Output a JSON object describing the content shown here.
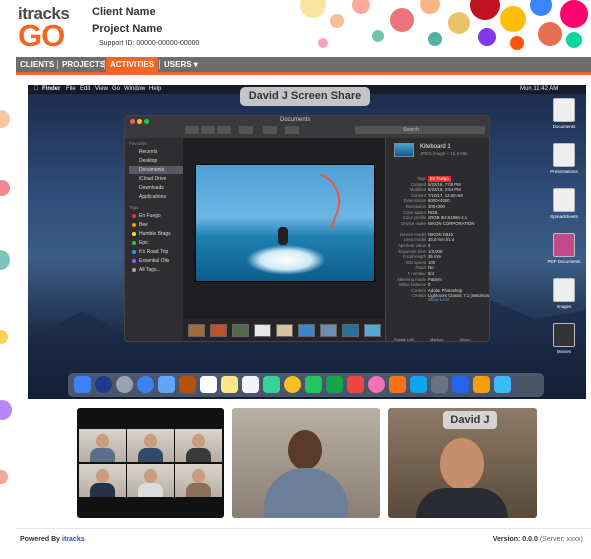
{
  "brand": {
    "logo_top": "itracks",
    "logo_bottom": "GO"
  },
  "header": {
    "client_name": "Client Name",
    "project_name": "Project Name",
    "support_id": "Support ID: 00000-00000-00000"
  },
  "nav": {
    "items": [
      "CLIENTS",
      "PROJECTS",
      "ACTIVITIES",
      "USERS ▾"
    ],
    "active": "ACTIVITIES"
  },
  "screen_share": {
    "label": "David J Screen Share",
    "menubar": {
      "apple": "",
      "items": [
        "Finder",
        "File",
        "Edit",
        "View",
        "Go",
        "Window",
        "Help"
      ],
      "clock": "Mon 11:42 AM"
    },
    "finder": {
      "title": "Documents",
      "search_placeholder": "Search",
      "sidebar_sections": [
        "Favorites",
        "Tags"
      ],
      "favorites": [
        "Recents",
        "Desktop",
        "Documents",
        "iCloud Drive",
        "Downloads",
        "Applications"
      ],
      "tags": [
        "En Fuego",
        "Bee",
        "Humble Brags",
        "Epic",
        "It's Road Trip",
        "Essential Oils",
        "All Tags..."
      ],
      "file": {
        "name": "Kiteboard 1",
        "type": "JPEG image – 15.4 MB"
      },
      "metadata": [
        [
          "Tags",
          "En Fuego"
        ],
        [
          "Created",
          "5/22/18, 7:09 PM"
        ],
        [
          "Modified",
          "5/22/18, 2:54 PM"
        ],
        [
          "Content",
          "7/10/17, 12:00 AM"
        ],
        [
          "Dimensions",
          "6000×4000"
        ],
        [
          "Resolution",
          "300×300"
        ],
        [
          "Color space",
          "RGB"
        ],
        [
          "Color profile",
          "sRGB IEC61966-2.1"
        ],
        [
          "Device make",
          "NIKON CORPORATION"
        ],
        [
          "Device model",
          "NIKON D810"
        ],
        [
          "Lens model",
          "35.0 mm f/1.4"
        ],
        [
          "Aperture value",
          "4"
        ],
        [
          "Exposure time",
          "1/3,000"
        ],
        [
          "Focal length",
          "35 mm"
        ],
        [
          "ISO speed",
          "100"
        ],
        [
          "Flash",
          "No"
        ],
        [
          "F number",
          "5/4"
        ],
        [
          "Metering mode",
          "Pattern"
        ],
        [
          "White balance",
          "0"
        ],
        [
          "Content",
          "Adobe Photoshop"
        ],
        [
          "Creator",
          "Lightroom Classic 7.1 (Macintosh)"
        ]
      ],
      "show_less": "Show Less",
      "actions": [
        "Rotate Left",
        "Markup",
        "More..."
      ]
    },
    "desktop_icons": [
      "Documents",
      "Presentations",
      "Spreadsheets",
      "PDF Documents",
      "Images",
      "Movies"
    ]
  },
  "video": {
    "participant_label": "David J"
  },
  "footer": {
    "powered_prefix": "Powered By",
    "powered_brand": "itracks",
    "version": "Version: 0.0.0",
    "server": "(Server: xxxx)"
  }
}
